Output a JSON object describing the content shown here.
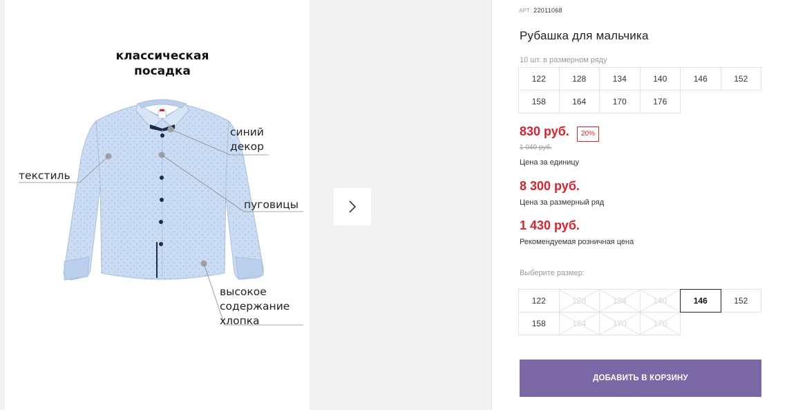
{
  "gallery": {
    "fit_title": "классическая посадка",
    "callouts": {
      "decor": "синий декор",
      "textile": "текстиль",
      "buttons": "пуговицы",
      "cotton": "высокое содержание хлопка"
    },
    "next_icon": "chevron-right-icon"
  },
  "product": {
    "article_label": "АРТ:",
    "article_value": "22011068",
    "title": "Рубашка для мальчика",
    "size_count": "10 шт. в размерном ряду",
    "size_range": [
      [
        "122",
        "128",
        "134",
        "140",
        "146",
        "152"
      ],
      [
        "158",
        "164",
        "170",
        "176"
      ]
    ],
    "price": "830 руб.",
    "discount": "20%",
    "old_price": "1 040 руб.",
    "price_unit_label": "Цена за единицу",
    "range_price": "8 300 руб.",
    "range_price_label": "Цена за размерный ряд",
    "retail_price": "1 430 руб.",
    "retail_price_label": "Рекомендуемая розничная цена",
    "choose_size_label": "Выберите размер:",
    "selectable_sizes": [
      [
        {
          "label": "122",
          "state": "available"
        },
        {
          "label": "128",
          "state": "disabled"
        },
        {
          "label": "134",
          "state": "disabled"
        },
        {
          "label": "140",
          "state": "disabled"
        },
        {
          "label": "146",
          "state": "selected"
        },
        {
          "label": "152",
          "state": "available"
        }
      ],
      [
        {
          "label": "158",
          "state": "available"
        },
        {
          "label": "164",
          "state": "disabled"
        },
        {
          "label": "170",
          "state": "disabled"
        },
        {
          "label": "176",
          "state": "disabled"
        }
      ]
    ],
    "add_to_cart": "ДОБАВИТЬ В КОРЗИНУ"
  },
  "colors": {
    "price_red": "#d6232c",
    "cart_button": "#7b66a6",
    "shirt_blue": "#c9dcf3",
    "button_navy": "#1d2a4a"
  }
}
